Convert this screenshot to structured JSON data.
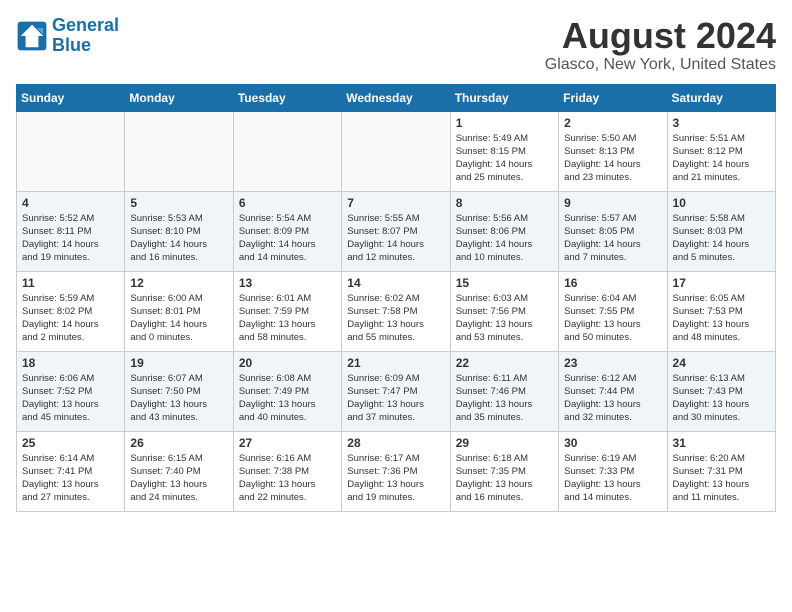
{
  "header": {
    "logo_line1": "General",
    "logo_line2": "Blue",
    "title": "August 2024",
    "subtitle": "Glasco, New York, United States"
  },
  "days_of_week": [
    "Sunday",
    "Monday",
    "Tuesday",
    "Wednesday",
    "Thursday",
    "Friday",
    "Saturday"
  ],
  "weeks": [
    [
      {
        "day": "",
        "info": ""
      },
      {
        "day": "",
        "info": ""
      },
      {
        "day": "",
        "info": ""
      },
      {
        "day": "",
        "info": ""
      },
      {
        "day": "1",
        "info": "Sunrise: 5:49 AM\nSunset: 8:15 PM\nDaylight: 14 hours\nand 25 minutes."
      },
      {
        "day": "2",
        "info": "Sunrise: 5:50 AM\nSunset: 8:13 PM\nDaylight: 14 hours\nand 23 minutes."
      },
      {
        "day": "3",
        "info": "Sunrise: 5:51 AM\nSunset: 8:12 PM\nDaylight: 14 hours\nand 21 minutes."
      }
    ],
    [
      {
        "day": "4",
        "info": "Sunrise: 5:52 AM\nSunset: 8:11 PM\nDaylight: 14 hours\nand 19 minutes."
      },
      {
        "day": "5",
        "info": "Sunrise: 5:53 AM\nSunset: 8:10 PM\nDaylight: 14 hours\nand 16 minutes."
      },
      {
        "day": "6",
        "info": "Sunrise: 5:54 AM\nSunset: 8:09 PM\nDaylight: 14 hours\nand 14 minutes."
      },
      {
        "day": "7",
        "info": "Sunrise: 5:55 AM\nSunset: 8:07 PM\nDaylight: 14 hours\nand 12 minutes."
      },
      {
        "day": "8",
        "info": "Sunrise: 5:56 AM\nSunset: 8:06 PM\nDaylight: 14 hours\nand 10 minutes."
      },
      {
        "day": "9",
        "info": "Sunrise: 5:57 AM\nSunset: 8:05 PM\nDaylight: 14 hours\nand 7 minutes."
      },
      {
        "day": "10",
        "info": "Sunrise: 5:58 AM\nSunset: 8:03 PM\nDaylight: 14 hours\nand 5 minutes."
      }
    ],
    [
      {
        "day": "11",
        "info": "Sunrise: 5:59 AM\nSunset: 8:02 PM\nDaylight: 14 hours\nand 2 minutes."
      },
      {
        "day": "12",
        "info": "Sunrise: 6:00 AM\nSunset: 8:01 PM\nDaylight: 14 hours\nand 0 minutes."
      },
      {
        "day": "13",
        "info": "Sunrise: 6:01 AM\nSunset: 7:59 PM\nDaylight: 13 hours\nand 58 minutes."
      },
      {
        "day": "14",
        "info": "Sunrise: 6:02 AM\nSunset: 7:58 PM\nDaylight: 13 hours\nand 55 minutes."
      },
      {
        "day": "15",
        "info": "Sunrise: 6:03 AM\nSunset: 7:56 PM\nDaylight: 13 hours\nand 53 minutes."
      },
      {
        "day": "16",
        "info": "Sunrise: 6:04 AM\nSunset: 7:55 PM\nDaylight: 13 hours\nand 50 minutes."
      },
      {
        "day": "17",
        "info": "Sunrise: 6:05 AM\nSunset: 7:53 PM\nDaylight: 13 hours\nand 48 minutes."
      }
    ],
    [
      {
        "day": "18",
        "info": "Sunrise: 6:06 AM\nSunset: 7:52 PM\nDaylight: 13 hours\nand 45 minutes."
      },
      {
        "day": "19",
        "info": "Sunrise: 6:07 AM\nSunset: 7:50 PM\nDaylight: 13 hours\nand 43 minutes."
      },
      {
        "day": "20",
        "info": "Sunrise: 6:08 AM\nSunset: 7:49 PM\nDaylight: 13 hours\nand 40 minutes."
      },
      {
        "day": "21",
        "info": "Sunrise: 6:09 AM\nSunset: 7:47 PM\nDaylight: 13 hours\nand 37 minutes."
      },
      {
        "day": "22",
        "info": "Sunrise: 6:11 AM\nSunset: 7:46 PM\nDaylight: 13 hours\nand 35 minutes."
      },
      {
        "day": "23",
        "info": "Sunrise: 6:12 AM\nSunset: 7:44 PM\nDaylight: 13 hours\nand 32 minutes."
      },
      {
        "day": "24",
        "info": "Sunrise: 6:13 AM\nSunset: 7:43 PM\nDaylight: 13 hours\nand 30 minutes."
      }
    ],
    [
      {
        "day": "25",
        "info": "Sunrise: 6:14 AM\nSunset: 7:41 PM\nDaylight: 13 hours\nand 27 minutes."
      },
      {
        "day": "26",
        "info": "Sunrise: 6:15 AM\nSunset: 7:40 PM\nDaylight: 13 hours\nand 24 minutes."
      },
      {
        "day": "27",
        "info": "Sunrise: 6:16 AM\nSunset: 7:38 PM\nDaylight: 13 hours\nand 22 minutes."
      },
      {
        "day": "28",
        "info": "Sunrise: 6:17 AM\nSunset: 7:36 PM\nDaylight: 13 hours\nand 19 minutes."
      },
      {
        "day": "29",
        "info": "Sunrise: 6:18 AM\nSunset: 7:35 PM\nDaylight: 13 hours\nand 16 minutes."
      },
      {
        "day": "30",
        "info": "Sunrise: 6:19 AM\nSunset: 7:33 PM\nDaylight: 13 hours\nand 14 minutes."
      },
      {
        "day": "31",
        "info": "Sunrise: 6:20 AM\nSunset: 7:31 PM\nDaylight: 13 hours\nand 11 minutes."
      }
    ]
  ]
}
